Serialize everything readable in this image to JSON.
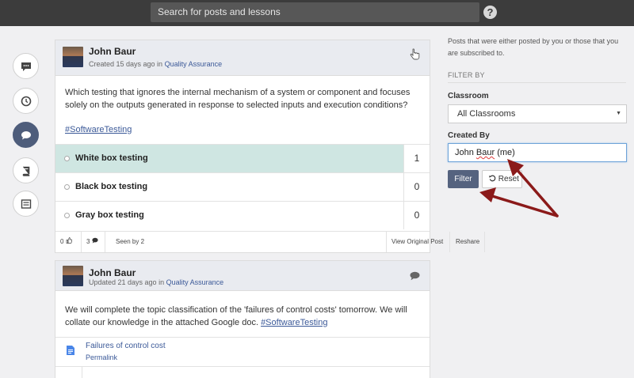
{
  "search": {
    "placeholder": "Search for posts and lessons"
  },
  "help_icon": "?",
  "rail": [
    "chat-bubble-icon",
    "clock-icon",
    "comment-icon",
    "book-icon",
    "list-icon"
  ],
  "post1": {
    "author": "John Baur",
    "meta_prefix": "Created 15 days ago in ",
    "meta_link": "Quality Assurance",
    "question": "Which testing that ignores the internal mechanism of a system or component and focuses solely on the outputs generated in response to selected inputs and execution conditions?",
    "hashtag": "#SoftwareTesting",
    "options": [
      {
        "label": "White box testing",
        "count": "1"
      },
      {
        "label": "Black box testing",
        "count": "0"
      },
      {
        "label": "Gray box testing",
        "count": "0"
      }
    ],
    "footer": {
      "likes": "0",
      "comments": "3",
      "seen": "Seen by 2",
      "view_original": "View Original Post",
      "reshare": "Reshare"
    }
  },
  "post2": {
    "author": "John Baur",
    "meta_prefix": "Updated 21 days ago in ",
    "meta_link": "Quality Assurance",
    "text": "We will complete the topic classification of the 'failures of control costs' tomorrow. We will collate our knowledge in the attached Google doc. ",
    "hashtag": "#SoftwareTesting",
    "attachment": "Failures of control cost",
    "permalink": "Permalink"
  },
  "filters": {
    "intro": "Posts that were either posted by you or those that you are subscribed to.",
    "filter_by": "FILTER BY",
    "classroom_label": "Classroom",
    "classroom_value": "All Classrooms",
    "created_by_label": "Created By",
    "created_by_value_a": "John ",
    "created_by_value_b": "Baur",
    "created_by_value_c": " (me)",
    "filter_btn": "Filter",
    "reset_btn": "Reset"
  },
  "colors": {
    "topbar": "#3c3c3c",
    "accent": "#55637f",
    "selected_option": "#cfe6e2",
    "annotation_arrow": "#8b1a1a"
  }
}
